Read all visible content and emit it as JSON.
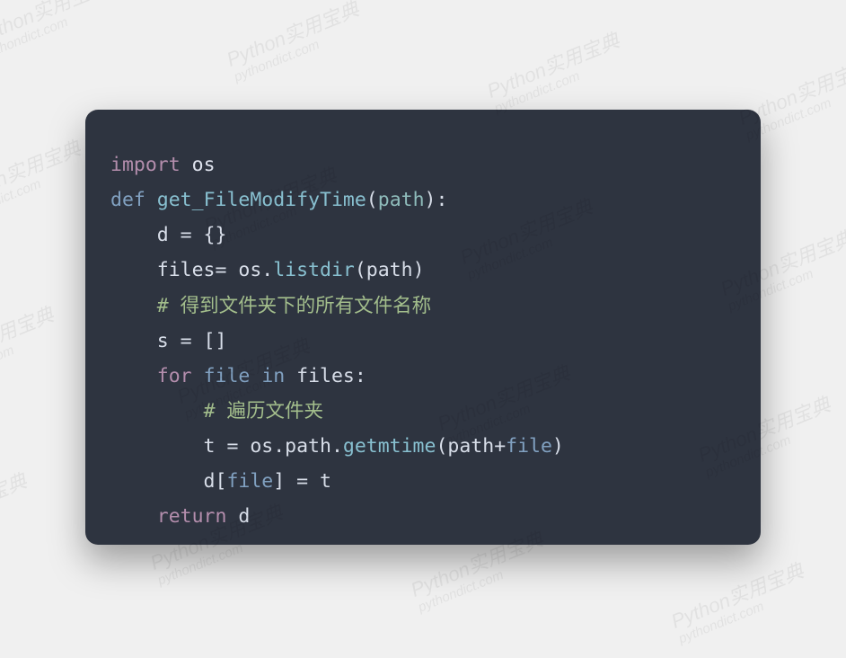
{
  "watermark": {
    "line1": "Python实用宝典",
    "line2": "pythondict.com"
  },
  "code": {
    "l1": {
      "kw": "import",
      "mod": "os"
    },
    "l2": {
      "kw": "def",
      "fn": "get_FileModifyTime",
      "param": "path"
    },
    "l3": "    d = {}",
    "l4": {
      "prefix": "    files= os.",
      "call": "listdir",
      "arg": "path",
      "close": ")"
    },
    "l5": {
      "indent": "    ",
      "comment": "# 得到文件夹下的所有文件名称"
    },
    "l6": "    s = []",
    "l7": {
      "kw_for": "for",
      "var": "file",
      "kw_in": "in",
      "iter": "files",
      "colon": ":"
    },
    "l8": {
      "indent": "        ",
      "comment": "# 遍历文件夹"
    },
    "l9": {
      "prefix": "        t = os.path.",
      "call": "getmtime",
      "arg_a": "path",
      "op": "+",
      "arg_b": "file",
      "close": ")"
    },
    "l10": {
      "prefix": "        d[",
      "key": "file",
      "suffix": "] = t"
    },
    "l11": {
      "kw": "return",
      "rest": " d"
    }
  }
}
